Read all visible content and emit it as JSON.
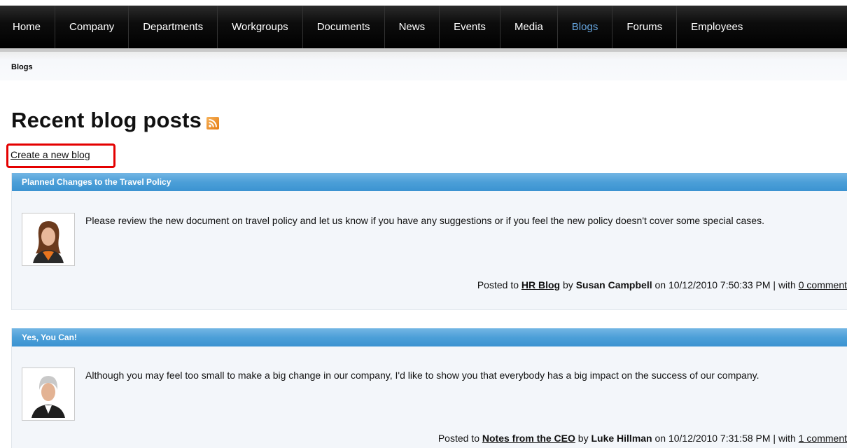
{
  "nav": {
    "items": [
      {
        "label": "Home",
        "active": false
      },
      {
        "label": "Company",
        "active": false
      },
      {
        "label": "Departments",
        "active": false
      },
      {
        "label": "Workgroups",
        "active": false
      },
      {
        "label": "Documents",
        "active": false
      },
      {
        "label": "News",
        "active": false
      },
      {
        "label": "Events",
        "active": false
      },
      {
        "label": "Media",
        "active": false
      },
      {
        "label": "Blogs",
        "active": true
      },
      {
        "label": "Forums",
        "active": false
      },
      {
        "label": "Employees",
        "active": false
      }
    ]
  },
  "breadcrumb": {
    "current": "Blogs"
  },
  "page": {
    "title": "Recent blog posts",
    "rss_icon": "rss-feed-icon",
    "create_link": "Create a new blog"
  },
  "posts": [
    {
      "title": "Planned Changes to the Travel Policy",
      "body": "Please review the new document on travel policy and let us know if you have any suggestions or if you feel the new policy doesn't cover some special cases.",
      "posted_to_label": "Posted to",
      "blog": "HR Blog",
      "by_label": "by",
      "author": "Susan Campbell",
      "on_label": "on",
      "date": "10/12/2010 7:50:33 PM",
      "with_label": "| with",
      "comments": "0 comment"
    },
    {
      "title": "Yes, You Can!",
      "body": "Although you may feel too small to make a big change in our company, I'd like to show you that everybody has a big impact on the success of our company.",
      "posted_to_label": "Posted to",
      "blog": "Notes from the CEO",
      "by_label": "by",
      "author": "Luke Hillman",
      "on_label": "on",
      "date": "10/12/2010 7:31:58 PM",
      "with_label": "| with",
      "comments": "1 comment"
    }
  ],
  "colors": {
    "nav_bg": "#000000",
    "nav_active": "#66a6e0",
    "post_header": "#4c9fd8",
    "post_bg": "#f3f6fa",
    "highlight": "#e40000"
  }
}
